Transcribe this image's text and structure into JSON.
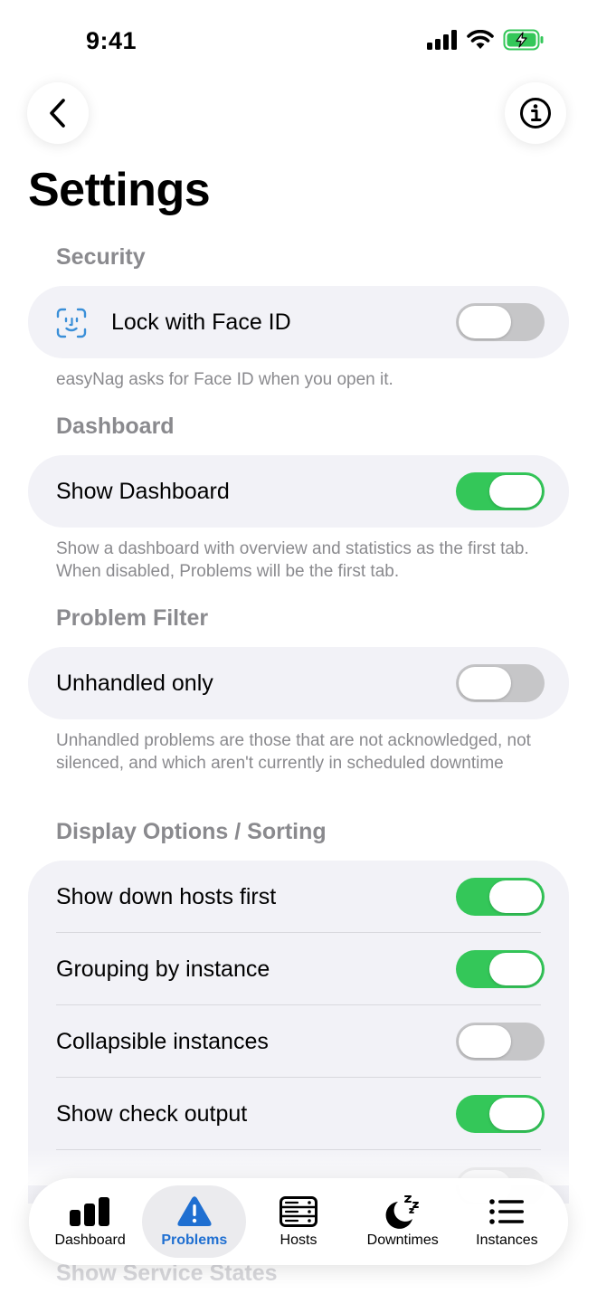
{
  "status_bar": {
    "time": "9:41"
  },
  "page": {
    "title": "Settings"
  },
  "sections": {
    "security": {
      "header": "Security",
      "lock_face_id": {
        "label": "Lock with Face ID",
        "enabled": false,
        "icon": "face-id-icon"
      },
      "footnote": "easyNag asks for Face ID when you open it."
    },
    "dashboard": {
      "header": "Dashboard",
      "show_dashboard": {
        "label": "Show Dashboard",
        "enabled": true
      },
      "footnote": "Show a dashboard with overview and statistics as the first tab. When disabled, Problems will be the first tab."
    },
    "problem_filter": {
      "header": "Problem Filter",
      "unhandled_only": {
        "label": "Unhandled only",
        "enabled": false
      },
      "footnote": "Unhandled problems are those that are not acknowledged, not silenced, and which aren't currently in scheduled downtime"
    },
    "display_options": {
      "header": "Display Options / Sorting",
      "rows": [
        {
          "label": "Show down hosts first",
          "enabled": true
        },
        {
          "label": "Grouping by instance",
          "enabled": true
        },
        {
          "label": "Collapsible instances",
          "enabled": false
        },
        {
          "label": "Show check output",
          "enabled": true
        }
      ]
    }
  },
  "next_header": "Show Service States",
  "tab_bar": {
    "active": "Problems",
    "tabs": [
      {
        "label": "Dashboard",
        "icon": "chart-bars-icon"
      },
      {
        "label": "Problems",
        "icon": "warning-icon"
      },
      {
        "label": "Hosts",
        "icon": "server-icon"
      },
      {
        "label": "Downtimes",
        "icon": "moon-sleep-icon"
      },
      {
        "label": "Instances",
        "icon": "list-icon"
      }
    ]
  },
  "colors": {
    "toggle_on": "#34c759",
    "toggle_off": "#c6c6c8",
    "accent": "#1f6fd1",
    "face_id": "#3a8fd8"
  }
}
